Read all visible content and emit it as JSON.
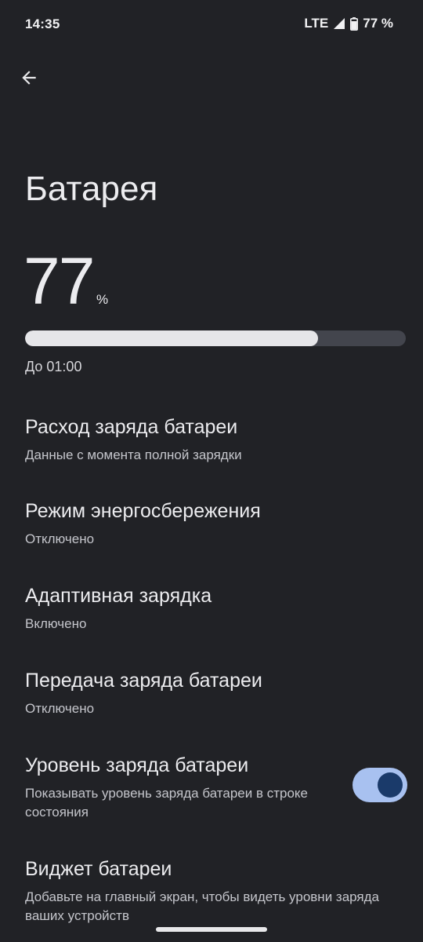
{
  "status_bar": {
    "time": "14:35",
    "network": "LTE",
    "battery_percent": "77 %"
  },
  "header": {
    "back_icon": "arrow-back-icon"
  },
  "page": {
    "title": "Батарея"
  },
  "battery": {
    "value": "77",
    "unit": "%",
    "level_fraction": 0.77,
    "until": "До 01:00"
  },
  "preferences": [
    {
      "title": "Расход заряда батареи",
      "summary": "Данные с момента полной зарядки"
    },
    {
      "title": "Режим энергосбережения",
      "summary": "Отключено"
    },
    {
      "title": "Адаптивная зарядка",
      "summary": "Включено"
    },
    {
      "title": "Передача заряда батареи",
      "summary": "Отключено"
    },
    {
      "title": "Уровень заряда батареи",
      "summary": "Показывать уровень заряда батареи в строке состояния",
      "toggle_on": true
    },
    {
      "title": "Виджет батареи",
      "summary": "Добавьте на главный экран, чтобы видеть уровни заряда ваших устройств"
    }
  ],
  "colors": {
    "background": "#212226",
    "toggle_track": "#a8c1f0",
    "toggle_knob": "#1a3a6a"
  }
}
